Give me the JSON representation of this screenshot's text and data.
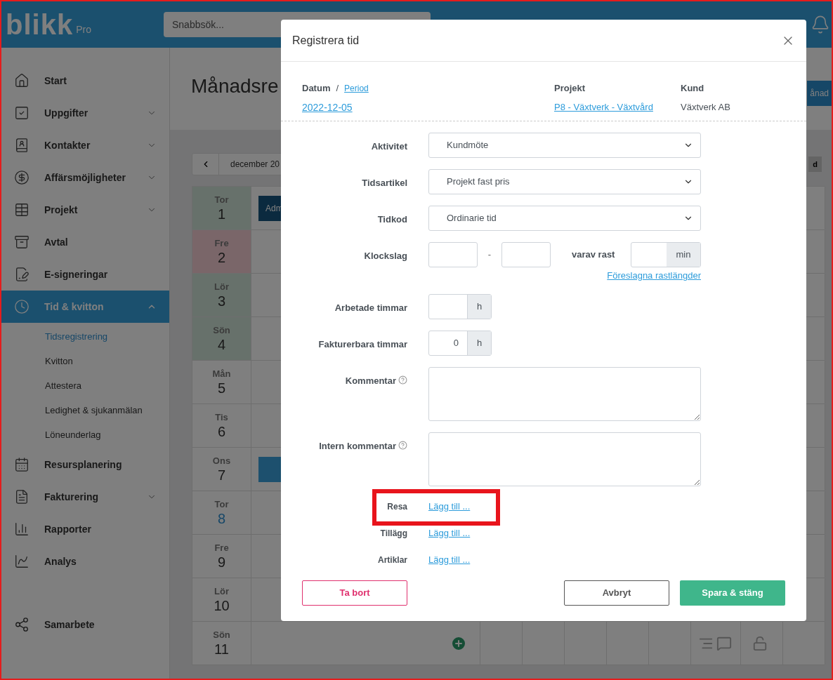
{
  "header": {
    "logo": "blikk",
    "logo_suffix": "Pro",
    "search_placeholder": "Snabbsök..."
  },
  "sidebar": {
    "items": [
      {
        "label": "Start",
        "selected": false
      },
      {
        "label": "Uppgifter",
        "expanded": false,
        "selected": false
      },
      {
        "label": "Kontakter",
        "expanded": false,
        "selected": false
      },
      {
        "label": "Affärsmöjligheter",
        "expanded": false,
        "selected": false
      },
      {
        "label": "Projekt",
        "expanded": false,
        "selected": false
      },
      {
        "label": "Avtal",
        "selected": false
      },
      {
        "label": "E-signeringar",
        "selected": false
      },
      {
        "label": "Tid & kvitton",
        "expanded": true,
        "selected": true,
        "children": [
          {
            "label": "Tidsregistrering",
            "selected": true
          },
          {
            "label": "Kvitton",
            "selected": false
          },
          {
            "label": "Attestera",
            "selected": false
          },
          {
            "label": "Ledighet & sjukanmälan",
            "selected": false
          },
          {
            "label": "Löneunderlag",
            "selected": false
          }
        ]
      },
      {
        "label": "Resursplanering",
        "selected": false
      },
      {
        "label": "Fakturering",
        "expanded": false,
        "selected": false
      },
      {
        "label": "Rapporter",
        "selected": false
      },
      {
        "label": "Analys",
        "selected": false
      }
    ],
    "footer_items": [
      {
        "label": "Samarbete",
        "selected": false
      }
    ]
  },
  "main": {
    "title": "Månadsre",
    "view_button": "ånad",
    "toolbar_button": "d",
    "month_label": "december 20",
    "days": [
      {
        "weekday": "Tor",
        "day": "1",
        "kind": "holiday",
        "event": {
          "kind": "labeled",
          "label": "Adm"
        }
      },
      {
        "weekday": "Fre",
        "day": "2",
        "kind": "red"
      },
      {
        "weekday": "Lör",
        "day": "3",
        "kind": "holiday"
      },
      {
        "weekday": "Sön",
        "day": "4",
        "kind": "holiday"
      },
      {
        "weekday": "Mån",
        "day": "5",
        "kind": "normal"
      },
      {
        "weekday": "Tis",
        "day": "6",
        "kind": "normal"
      },
      {
        "weekday": "Ons",
        "day": "7",
        "kind": "normal",
        "event": {
          "kind": "bar"
        }
      },
      {
        "weekday": "Tor",
        "day": "8",
        "kind": "today"
      },
      {
        "weekday": "Fre",
        "day": "9",
        "kind": "normal"
      },
      {
        "weekday": "Lör",
        "day": "10",
        "kind": "normal"
      },
      {
        "weekday": "Sön",
        "day": "11",
        "kind": "normal",
        "tools": true
      }
    ]
  },
  "modal": {
    "title": "Registrera tid",
    "info": {
      "date_label": "Datum",
      "separator": "/",
      "period_link": "Period",
      "date": "2022-12-05",
      "project_label": "Projekt",
      "project": "P8 - Växtverk - Växtvård",
      "customer_label": "Kund",
      "customer": "Växtverk AB"
    },
    "fields": [
      {
        "kind": "select",
        "label": "Aktivitet",
        "value": "Kundmöte"
      },
      {
        "kind": "select",
        "label": "Tidsartikel",
        "value": "Projekt fast pris"
      },
      {
        "kind": "select",
        "label": "Tidkod",
        "value": "Ordinarie tid"
      },
      {
        "kind": "time-range",
        "label": "Klockslag",
        "separator": "-",
        "break_label": "varav rast",
        "break_unit": "min",
        "link": "Föreslagna rastlängder"
      },
      {
        "kind": "unit",
        "label": "Arbetade timmar",
        "unit": "h"
      },
      {
        "kind": "unit",
        "label": "Fakturerbara timmar",
        "value": "0",
        "unit": "h"
      },
      {
        "kind": "textarea",
        "label": "Kommentar",
        "help": true
      },
      {
        "kind": "textarea",
        "label": "Intern kommentar",
        "help": true
      }
    ],
    "extras": [
      {
        "label": "Resa",
        "link": "Lägg till ...",
        "highlighted": true
      },
      {
        "label": "Tillägg",
        "link": "Lägg till ...",
        "highlighted": false
      },
      {
        "label": "Artiklar",
        "link": "Lägg till ...",
        "highlighted": false
      }
    ],
    "buttons": [
      {
        "label": "Ta bort",
        "kind": "danger"
      },
      {
        "label": "Avbryt",
        "kind": "secondary"
      },
      {
        "label": "Spara & stäng",
        "kind": "primary"
      }
    ]
  }
}
